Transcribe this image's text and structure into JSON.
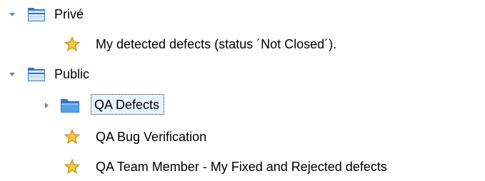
{
  "tree": {
    "nodes": [
      {
        "label": "Privé",
        "type": "folder",
        "expanded": true,
        "icon": "folder-open-icon"
      },
      {
        "label": "My detected defects (status ´Not Closed´).",
        "type": "favorite",
        "icon": "star-icon"
      },
      {
        "label": "Public",
        "type": "folder",
        "expanded": true,
        "icon": "folder-open-icon"
      },
      {
        "label": "QA Defects",
        "type": "folder",
        "expanded": false,
        "selected": true,
        "icon": "folder-icon"
      },
      {
        "label": "QA Bug Verification",
        "type": "favorite",
        "icon": "star-icon"
      },
      {
        "label": "QA Team Member - My Fixed and Rejected defects",
        "type": "favorite",
        "icon": "star-icon"
      }
    ]
  },
  "colors": {
    "expander_expanded": "#4d8fd1",
    "expander_collapsed": "#808080",
    "folder_body": "#dbe7f5",
    "folder_blue": "#2f78c8",
    "star_fill": "#f7c843",
    "star_stroke": "#c98a10",
    "selection_bg": "#e5f3ff"
  }
}
